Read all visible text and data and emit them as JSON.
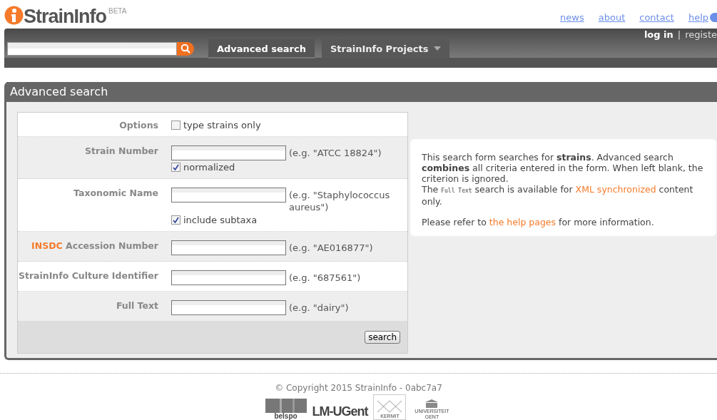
{
  "logo": {
    "name": "StrainInfo",
    "badge": "BETA"
  },
  "top_links": [
    {
      "label": "news"
    },
    {
      "label": "about"
    },
    {
      "label": "contact"
    },
    {
      "label": "help"
    }
  ],
  "account": {
    "login": "log in",
    "separator": "|",
    "register": "registe"
  },
  "nav": {
    "tabs": [
      {
        "label": "Advanced search",
        "selected": true,
        "dropdown": false
      },
      {
        "label": "StrainInfo Projects",
        "selected": false,
        "dropdown": true
      }
    ]
  },
  "panel": {
    "title": "Advanced search",
    "rows": [
      {
        "kind": "options",
        "label": "Options",
        "checkbox": {
          "label": "type strains only",
          "checked": false
        }
      },
      {
        "kind": "field",
        "label": "Strain Number",
        "hint": "(e.g. \"ATCC 18824\")",
        "checkbox": {
          "label": "normalized",
          "checked": true
        }
      },
      {
        "kind": "field",
        "label": "Taxonomic Name",
        "hint": "(e.g. \"Staphylococcus aureus\")",
        "checkbox": {
          "label": "include subtaxa",
          "checked": true
        }
      },
      {
        "kind": "field",
        "label_link": "INSDC",
        "label": "Accession Number",
        "hint": "(e.g. \"AE016877\")"
      },
      {
        "kind": "field",
        "label": "StrainInfo Culture Identifier",
        "hint": "(e.g. \"687561\")"
      },
      {
        "kind": "field",
        "label": "Full Text",
        "hint": "(e.g. \"dairy\")"
      }
    ],
    "submit": "search",
    "info": [
      [
        {
          "kind": "text",
          "text": "This search form searches for "
        },
        {
          "kind": "bold",
          "text": "strains"
        },
        {
          "kind": "text",
          "text": ". Advanced search "
        },
        {
          "kind": "bold",
          "text": "combines"
        },
        {
          "kind": "text",
          "text": " all criteria entered in the form. When left blank, the criterion is ignored."
        }
      ],
      [
        {
          "kind": "text",
          "text": "The "
        },
        {
          "kind": "code",
          "text": "Full Text"
        },
        {
          "kind": "text",
          "text": " search is available for "
        },
        {
          "kind": "link",
          "text": "XML synchronized"
        },
        {
          "kind": "text",
          "text": " content only."
        }
      ],
      [
        {
          "kind": "text",
          "text": "Please refer to "
        },
        {
          "kind": "link",
          "text": "the help pages"
        },
        {
          "kind": "text",
          "text": " for more information."
        }
      ]
    ]
  },
  "footer": {
    "copyright": "© Copyright 2015 StrainInfo - 0abc7a7",
    "logos": [
      {
        "kind": "belspo",
        "text": "belspo"
      },
      {
        "kind": "lm",
        "text": "LM-UGent"
      },
      {
        "kind": "kermit",
        "text": "KERMIT"
      },
      {
        "kind": "ugent",
        "text": "UNIVERSITEIT GENT"
      }
    ]
  }
}
